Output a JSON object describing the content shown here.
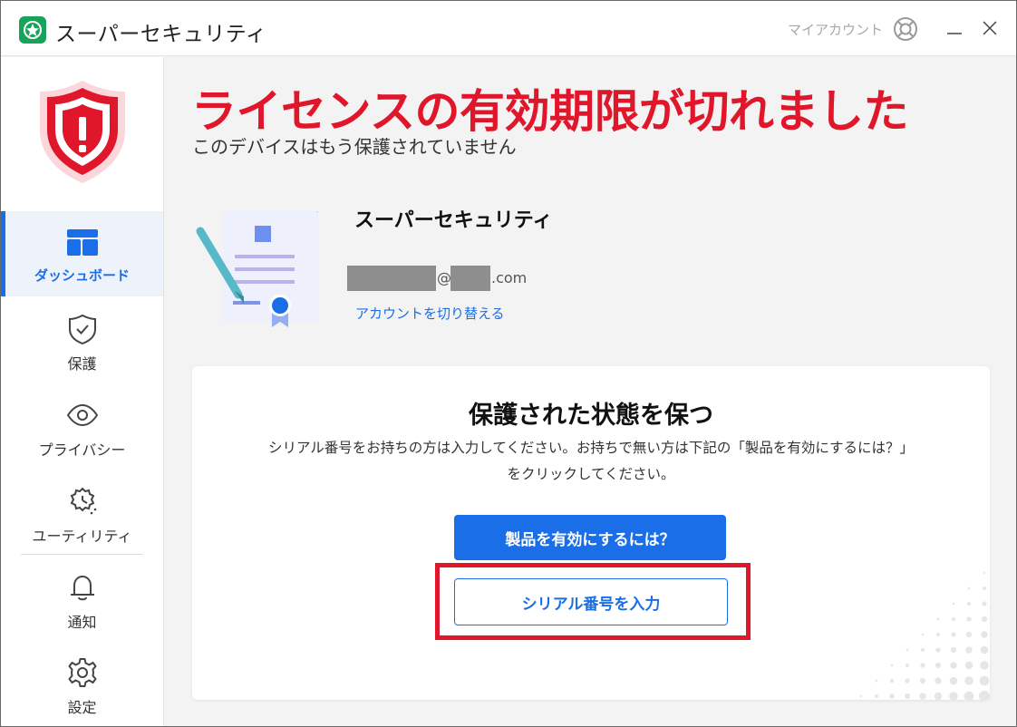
{
  "window": {
    "title": "スーパーセキュリティ",
    "my_account": "マイアカウント"
  },
  "sidebar": {
    "items": [
      {
        "label": "ダッシュボード",
        "icon": "dashboard-icon",
        "active": true
      },
      {
        "label": "保護",
        "icon": "shield-check-icon",
        "active": false
      },
      {
        "label": "プライバシー",
        "icon": "eye-icon",
        "active": false
      },
      {
        "label": "ユーティリティ",
        "icon": "utility-icon",
        "active": false
      },
      {
        "label": "通知",
        "icon": "bell-icon",
        "active": false
      },
      {
        "label": "設定",
        "icon": "gear-icon",
        "active": false
      }
    ]
  },
  "status": {
    "headline": "ライセンスの有効期限が切れました",
    "subline": "このデバイスはもう保護されていません"
  },
  "account": {
    "product_name": "スーパーセキュリティ",
    "email_at": "@",
    "email_domain": ".com",
    "switch_account": "アカウントを切り替える"
  },
  "card": {
    "title": "保護された状態を保つ",
    "description_line1": "シリアル番号をお持ちの方は入力してください。お持ちで無い方は下記の「製品を有効にするには？」",
    "description_line2": "をクリックしてください。",
    "activate_button": "製品を有効にするには？",
    "serial_button": "シリアル番号を入力"
  },
  "colors": {
    "accent": "#1a6fe8",
    "alert": "#e0162b",
    "brand": "#17a45a"
  }
}
